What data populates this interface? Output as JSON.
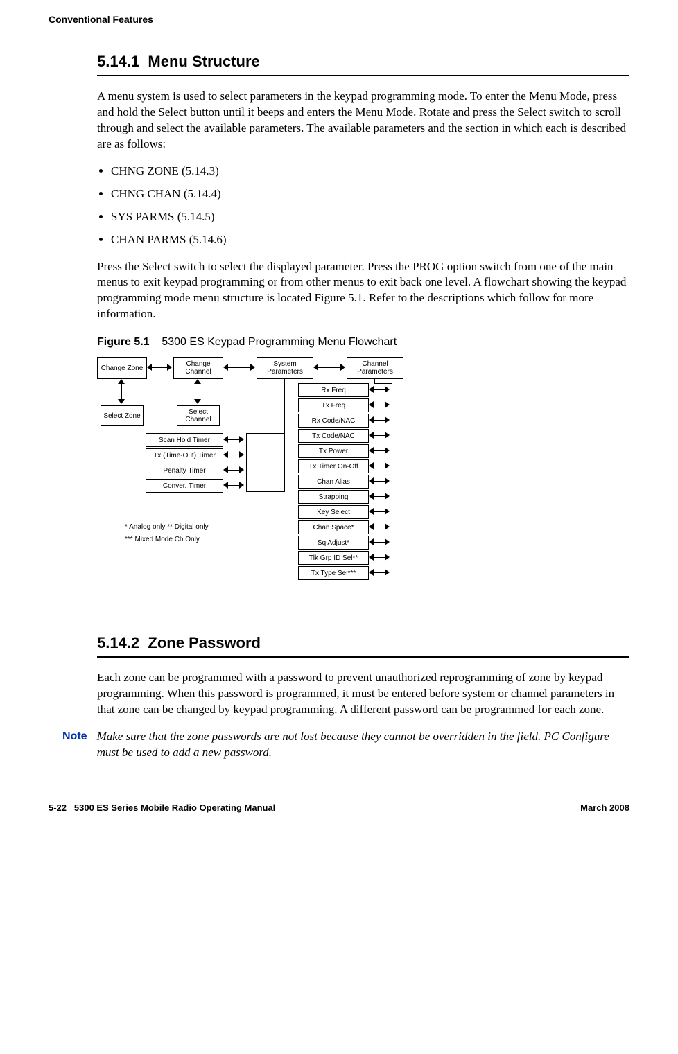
{
  "running_header": "Conventional Features",
  "section1": {
    "number": "5.14.1",
    "title": "Menu Structure",
    "para1": "A menu system is used to select parameters in the keypad programming mode. To enter the Menu Mode, press and hold the Select button until it beeps and enters the Menu Mode. Rotate and press the Select switch to scroll through and select the available parameters. The available parameters and the section in which each is described are as follows:",
    "bullets": [
      "CHNG ZONE (5.14.3)",
      "CHNG CHAN (5.14.4)",
      "SYS PARMS (5.14.5)",
      "CHAN PARMS (5.14.6)"
    ],
    "para2": "Press the Select switch to select the displayed parameter. Press the PROG option switch from one of the main menus to exit keypad programming or from other menus to exit back one level. A flowchart showing the keypad programming mode menu structure is located Figure 5.1. Refer to the descriptions which follow for more information."
  },
  "figure": {
    "label": "Figure 5.1",
    "title": "5300 ES Keypad Programming Menu Flowchart",
    "top_row": [
      "Change\nZone",
      "Change\nChannel",
      "System\nParameters",
      "Channel\nParameters"
    ],
    "left_second": [
      "Select\nZone",
      "Select\nChannel"
    ],
    "system_list": [
      "Scan Hold Timer",
      "Tx (Time-Out) Timer",
      "Penalty Timer",
      "Conver. Timer"
    ],
    "channel_list": [
      "Rx Freq",
      "Tx Freq",
      "Rx Code/NAC",
      "Tx Code/NAC",
      "Tx Power",
      "Tx Timer On-Off",
      "Chan Alias",
      "Strapping",
      "Key Select",
      "Chan Space*",
      "Sq Adjust*",
      "Tlk Grp ID Sel**",
      "Tx Type Sel***"
    ],
    "legend1": "* Analog only     ** Digital only",
    "legend2": "*** Mixed Mode Ch Only"
  },
  "section2": {
    "number": "5.14.2",
    "title": "Zone Password",
    "para1": "Each zone can be programmed with a password to prevent unauthorized reprogramming of zone by keypad programming. When this password is programmed, it must be entered before system or channel parameters in that zone can be changed by keypad programming. A different password can be programmed for each zone.",
    "note_label": "Note",
    "note_text": "Make sure that the zone passwords are not lost because they cannot be overridden in the field. PC Configure must be used to add a new password."
  },
  "footer": {
    "left_page": "5-22",
    "left_title": "5300 ES Series Mobile Radio Operating Manual",
    "right": "March 2008"
  }
}
